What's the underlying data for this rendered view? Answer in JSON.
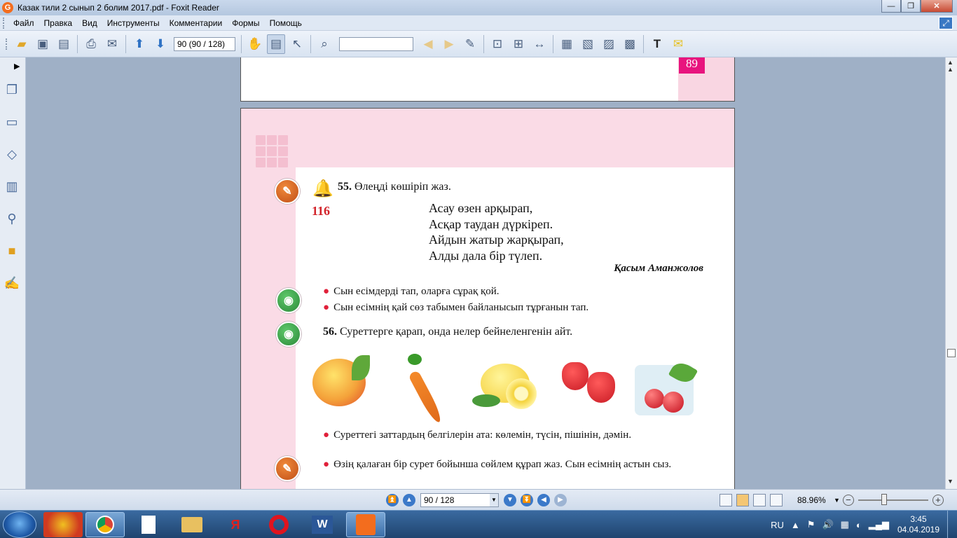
{
  "window": {
    "title": "Казак тили 2  сынып 2 болим 2017.pdf - Foxit Reader",
    "app_icon": "G"
  },
  "menu": [
    "Файл",
    "Правка",
    "Вид",
    "Инструменты",
    "Комментарии",
    "Формы",
    "Помощь"
  ],
  "toolbar": {
    "page_field": "90 (90 / 128)",
    "search_value": ""
  },
  "document": {
    "prev_page_number": "89",
    "task55_num": "55.",
    "task55_text": " Өлеңді көшіріп жаз.",
    "page_num_116": "116",
    "poem": [
      "Асау өзен арқырап,",
      "Асқар таудан дүркіреп.",
      "Айдын жатыр жарқырап,",
      "Алды дала бір түлеп."
    ],
    "author": "Қасым Аманжолов",
    "bullets55": [
      "Сын есімдерді тап, оларға сұрақ қой.",
      "Сын есімнің қай сөз табымен байланысып тұрғанын тап."
    ],
    "task56_num": "56.",
    "task56_text": " Суреттерге қарап, онда нелер бейнеленгенін айт.",
    "bullets56": [
      "Суреттегі заттардың белгілерін ата: көлемін, түсін, пішінін, дәмін.",
      "Өзің қалаған бір сурет бойынша сөйлем құрап жаз. Сын есімнің астын сыз."
    ]
  },
  "statusbar": {
    "page": "90 / 128",
    "zoom": "88.96%"
  },
  "taskbar": {
    "lang": "RU",
    "time": "3:45",
    "date": "04.04.2019",
    "yandex": "Я"
  },
  "colors": {
    "accent_pink": "#e8147e",
    "band_pink": "#fadbe6",
    "number_red": "#d2232a"
  }
}
